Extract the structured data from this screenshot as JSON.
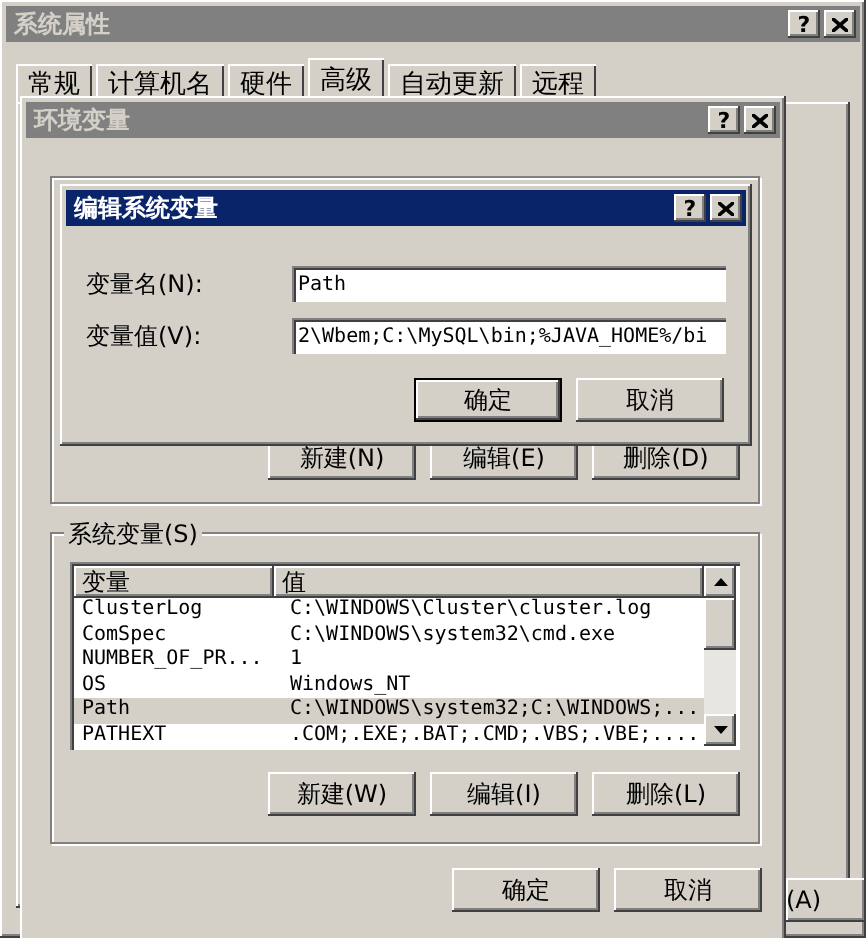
{
  "system_properties": {
    "title": "系统属性",
    "active": false,
    "help": "?",
    "tabs": [
      {
        "label": "常规",
        "selected": false
      },
      {
        "label": "计算机名",
        "selected": false
      },
      {
        "label": "硬件",
        "selected": false
      },
      {
        "label": "高级",
        "selected": true
      },
      {
        "label": "自动更新",
        "selected": false
      },
      {
        "label": "远程",
        "selected": false
      }
    ],
    "apply_button": "(A)"
  },
  "environment_variables": {
    "title": "环境变量",
    "active": false,
    "help": "?",
    "user_buttons": [
      "新建(N)",
      "编辑(E)",
      "删除(D)"
    ],
    "system_group": {
      "label": "系统变量(S)",
      "columns": [
        "变量",
        "值"
      ],
      "rows": [
        {
          "name": "ClusterLog",
          "value": "C:\\WINDOWS\\Cluster\\cluster.log",
          "selected": false
        },
        {
          "name": "ComSpec",
          "value": "C:\\WINDOWS\\system32\\cmd.exe",
          "selected": false
        },
        {
          "name": "NUMBER_OF_PR...",
          "value": "1",
          "selected": false
        },
        {
          "name": "OS",
          "value": "Windows_NT",
          "selected": false
        },
        {
          "name": "Path",
          "value": "C:\\WINDOWS\\system32;C:\\WINDOWS;...",
          "selected": true
        },
        {
          "name": "PATHEXT",
          "value": ".COM;.EXE;.BAT;.CMD;.VBS;.VBE;....",
          "selected": false
        }
      ]
    },
    "system_buttons": [
      "新建(W)",
      "编辑(I)",
      "删除(L)"
    ],
    "buttons": [
      "确定",
      "取消"
    ]
  },
  "edit_dialog": {
    "title": "编辑系统变量",
    "active": true,
    "help": "?",
    "fields": [
      {
        "label": "变量名(N):",
        "value": "Path"
      },
      {
        "label": "变量值(V):",
        "value": "2\\Wbem;C:\\MySQL\\bin;%JAVA_HOME%/bi"
      }
    ],
    "buttons": [
      {
        "label": "确定",
        "default": true
      },
      {
        "label": "取消",
        "default": false
      }
    ]
  }
}
